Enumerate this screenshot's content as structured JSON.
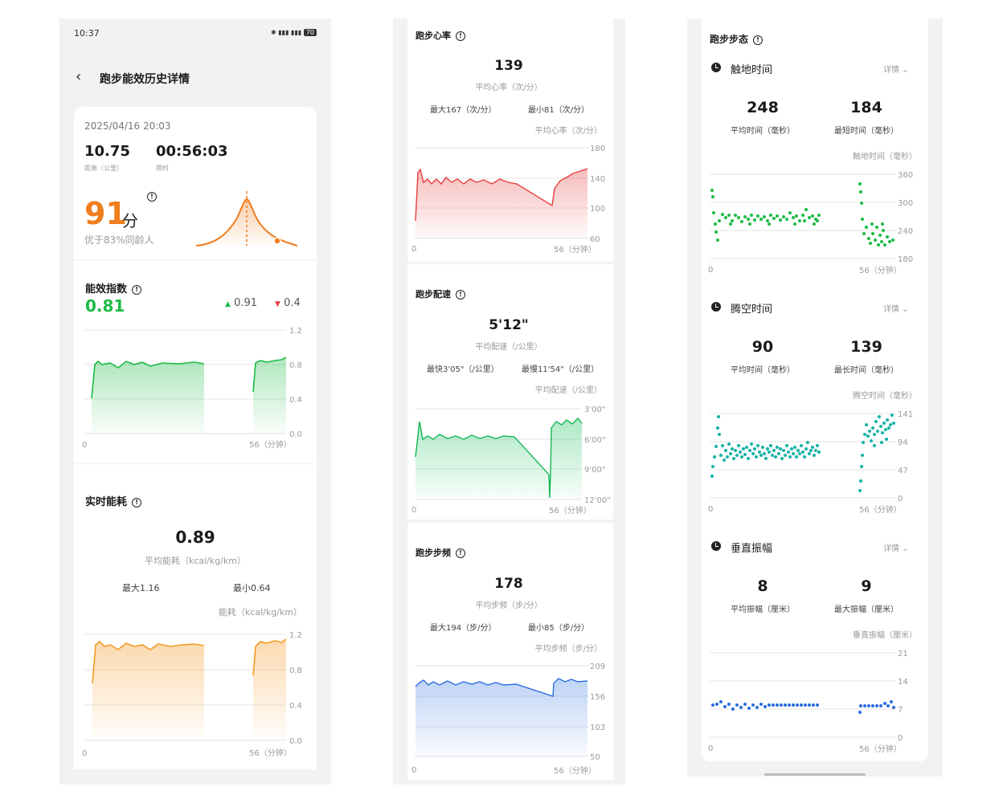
{
  "status_bar": {
    "time": "10:37",
    "battery": "70"
  },
  "header": {
    "title": "跑步能效历史详情"
  },
  "summary": {
    "datetime": "2025/04/16 20:03",
    "distance": "10.75",
    "distance_label": "距离（公里）",
    "duration": "00:56:03",
    "duration_label": "用时",
    "score": "91",
    "score_unit": "分",
    "percentile": "优于83%同龄人"
  },
  "efficiency": {
    "title": "能效指数",
    "value": "0.81",
    "up_value": "0.91",
    "down_value": "0.4",
    "y_ticks": [
      "1.2",
      "0.8",
      "0.4",
      "0.0"
    ],
    "x_start": "0",
    "x_end": "56（分钟）"
  },
  "energy": {
    "title": "实时能耗",
    "value": "0.89",
    "avg_label": "平均能耗（kcal/kg/km）",
    "max_label": "最大1.16",
    "min_label": "最小0.64",
    "unit_label": "能耗（kcal/kg/km）",
    "y_ticks": [
      "1.2",
      "0.8",
      "0.4",
      "0.0"
    ],
    "x_start": "0",
    "x_end": "56（分钟）"
  },
  "heart_rate": {
    "title": "跑步心率",
    "value": "139",
    "avg_label": "平均心率（次/分）",
    "max_label": "最大167（次/分）",
    "min_label": "最小81（次/分）",
    "unit_label": "平均心率（次/分）",
    "y_ticks": [
      "180",
      "140",
      "100",
      "60"
    ],
    "x_start": "0",
    "x_end": "56（分钟）"
  },
  "pace": {
    "title": "跑步配速",
    "value": "5'12\"",
    "avg_label": "平均配速（/公里）",
    "max_label": "最快3'05\"（/公里）",
    "min_label": "最慢11'54\"（/公里）",
    "unit_label": "平均配速（/公里）",
    "y_ticks": [
      "3'00\"",
      "6'00\"",
      "9'00\"",
      "12'00\""
    ],
    "x_start": "0",
    "x_end": "56（分钟）"
  },
  "cadence": {
    "title": "跑步步频",
    "value": "178",
    "avg_label": "平均步频（步/分）",
    "max_label": "最大194（步/分）",
    "min_label": "最小85（步/分）",
    "unit_label": "平均步频（步/分）",
    "y_ticks": [
      "209",
      "156",
      "103",
      "50"
    ],
    "x_start": "0",
    "x_end": "56（分钟）"
  },
  "gait": {
    "title": "跑步步态",
    "detail_label": "详情",
    "ground_contact": {
      "title": "触地时间",
      "avg": "248",
      "avg_label": "平均时间（毫秒）",
      "other": "184",
      "other_label": "最短时间（毫秒）",
      "unit_label": "触地时间（毫秒）",
      "y_ticks": [
        "360",
        "300",
        "240",
        "180"
      ],
      "x_start": "0",
      "x_end": "56（分钟）"
    },
    "flight_time": {
      "title": "腾空时间",
      "avg": "90",
      "avg_label": "平均时间（毫秒）",
      "other": "139",
      "other_label": "最长时间（毫秒）",
      "unit_label": "腾空时间（毫秒）",
      "y_ticks": [
        "141",
        "94",
        "47",
        "0"
      ],
      "x_start": "0",
      "x_end": "56（分钟）"
    },
    "vertical_osc": {
      "title": "垂直振幅",
      "avg": "8",
      "avg_label": "平均振幅（厘米）",
      "other": "9",
      "other_label": "最大振幅（厘米）",
      "unit_label": "垂直振幅（厘米）",
      "y_ticks": [
        "21",
        "14",
        "7",
        "0"
      ],
      "x_start": "0",
      "x_end": "56（分钟）"
    }
  },
  "colors": {
    "orange": "#f07d1e",
    "green": "#1dbb46",
    "red": "#e83e3e",
    "teal": "#14b3a6",
    "blue": "#2b6de0",
    "dark_green": "#14c05c"
  },
  "chart_data": [
    {
      "type": "area",
      "title": "能效指数",
      "x_range": [
        0,
        56
      ],
      "ylim": [
        0,
        1.2
      ],
      "series": [
        {
          "values_seg1": [
            [
              0,
              0.4
            ],
            [
              1,
              0.85
            ],
            [
              2,
              0.88
            ],
            [
              5,
              0.82
            ],
            [
              8,
              0.87
            ],
            [
              12,
              0.83
            ],
            [
              15,
              0.88
            ],
            [
              20,
              0.86
            ],
            [
              25,
              0.87
            ],
            [
              30,
              0.86
            ]
          ],
          "values_seg2": [
            [
              42,
              0.45
            ],
            [
              43,
              0.82
            ],
            [
              46,
              0.86
            ],
            [
              50,
              0.87
            ],
            [
              53,
              0.91
            ]
          ]
        }
      ]
    },
    {
      "type": "area",
      "title": "实时能耗",
      "x_range": [
        0,
        56
      ],
      "ylim": [
        0,
        1.2
      ],
      "series": [
        {
          "values_seg1": [
            [
              0,
              0.64
            ],
            [
              1,
              1.1
            ],
            [
              3,
              1.05
            ],
            [
              6,
              1.1
            ],
            [
              9,
              1.02
            ],
            [
              12,
              1.1
            ],
            [
              15,
              1.06
            ],
            [
              20,
              1.1
            ],
            [
              25,
              1.08
            ],
            [
              30,
              1.09
            ]
          ],
          "values_seg2": [
            [
              42,
              0.75
            ],
            [
              43,
              1.08
            ],
            [
              46,
              1.12
            ],
            [
              50,
              1.1
            ],
            [
              53,
              1.16
            ]
          ]
        }
      ]
    },
    {
      "type": "area",
      "title": "跑步心率",
      "x_range": [
        0,
        56
      ],
      "ylim": [
        60,
        180
      ],
      "series": [
        {
          "values": [
            [
              0,
              81
            ],
            [
              0.5,
              150
            ],
            [
              2,
              138
            ],
            [
              5,
              140
            ],
            [
              10,
              137
            ],
            [
              15,
              141
            ],
            [
              20,
              138
            ],
            [
              25,
              140
            ],
            [
              28,
              137
            ],
            [
              38,
              98
            ],
            [
              39,
              130
            ],
            [
              42,
              142
            ],
            [
              46,
              145
            ],
            [
              50,
              148
            ],
            [
              53,
              152
            ]
          ]
        }
      ]
    },
    {
      "type": "area",
      "title": "跑步配速",
      "x_range": [
        0,
        56
      ],
      "ylim": [
        "12'00\"",
        "3'00\""
      ],
      "series": [
        {
          "values_min": [
            [
              0,
              6.5
            ],
            [
              0.5,
              4.2
            ],
            [
              2,
              5.5
            ],
            [
              10,
              5.4
            ],
            [
              20,
              5.3
            ],
            [
              28,
              5.2
            ],
            [
              37,
              11.9
            ],
            [
              37.5,
              5
            ],
            [
              42,
              3.6
            ],
            [
              46,
              3.5
            ],
            [
              50,
              3.3
            ],
            [
              53,
              3.1
            ]
          ]
        }
      ]
    },
    {
      "type": "area",
      "title": "跑步步频",
      "x_range": [
        0,
        56
      ],
      "ylim": [
        50,
        209
      ],
      "series": [
        {
          "values": [
            [
              0,
              172
            ],
            [
              1,
              180
            ],
            [
              5,
              178
            ],
            [
              10,
              180
            ],
            [
              15,
              177
            ],
            [
              20,
              178
            ],
            [
              28,
              176
            ],
            [
              38,
              160
            ],
            [
              39,
              182
            ],
            [
              45,
              183
            ],
            [
              50,
              182
            ],
            [
              53,
              181
            ]
          ]
        }
      ]
    },
    {
      "type": "scatter",
      "title": "触地时间",
      "x_range": [
        0,
        56
      ],
      "ylim": [
        180,
        360
      ],
      "note": "seg1 ≈ 250–270ms, seg2 ≈ 215–240ms"
    },
    {
      "type": "scatter",
      "title": "腾空时间",
      "x_range": [
        0,
        56
      ],
      "ylim": [
        0,
        141
      ],
      "note": "seg1 ≈ 70–110ms, seg2 ≈ 95–135ms"
    },
    {
      "type": "scatter",
      "title": "垂直振幅",
      "x_range": [
        0,
        56
      ],
      "ylim": [
        0,
        21
      ],
      "note": "≈ 8–9cm"
    }
  ]
}
